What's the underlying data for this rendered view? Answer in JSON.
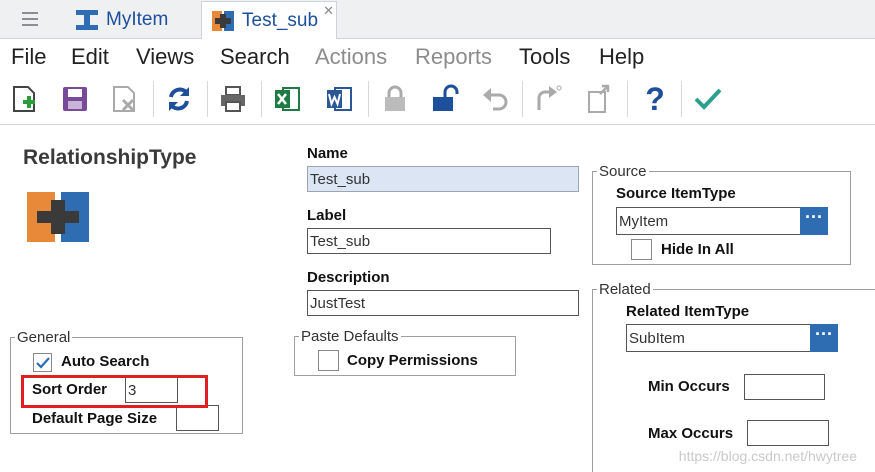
{
  "tabs": [
    {
      "label": "MyItem"
    },
    {
      "label": "Test_sub",
      "close": "✕"
    }
  ],
  "menu": [
    {
      "label": "File",
      "enabled": true
    },
    {
      "label": "Edit",
      "enabled": true
    },
    {
      "label": "Views",
      "enabled": true
    },
    {
      "label": "Search",
      "enabled": true
    },
    {
      "label": "Actions",
      "enabled": false
    },
    {
      "label": "Reports",
      "enabled": false
    },
    {
      "label": "Tools",
      "enabled": true
    },
    {
      "label": "Help",
      "enabled": true
    }
  ],
  "toolbar_icons": [
    "new-icon",
    "save-icon",
    "delete-icon",
    "refresh-icon",
    "print-icon",
    "excel-icon",
    "word-icon",
    "lock-icon",
    "unlock-icon",
    "undo-icon",
    "promote-icon",
    "export-icon",
    "help-icon",
    "done-icon"
  ],
  "colors": {
    "accent": "#1e4f9a",
    "orange": "#e8893a",
    "blue": "#2f6db3",
    "red": "#e02020",
    "green": "#2e9e8e"
  },
  "form": {
    "title": "RelationshipType",
    "name_label": "Name",
    "name_value": "Test_sub",
    "label_label": "Label",
    "label_value": "Test_sub",
    "description_label": "Description",
    "description_value": "JustTest",
    "general_legend": "General",
    "auto_search_label": "Auto Search",
    "auto_search_checked": true,
    "sort_order_label": "Sort Order",
    "sort_order_value": "3",
    "default_page_size_label": "Default Page Size",
    "default_page_size_value": "",
    "paste_defaults_legend": "Paste Defaults",
    "copy_permissions_label": "Copy Permissions",
    "copy_permissions_checked": false,
    "source_legend": "Source",
    "source_itemtype_label": "Source ItemType",
    "source_itemtype_value": "MyItem",
    "hide_in_all_label": "Hide In All",
    "hide_in_all_checked": false,
    "related_legend": "Related",
    "related_itemtype_label": "Related ItemType",
    "related_itemtype_value": "SubItem",
    "min_occurs_label": "Min Occurs",
    "min_occurs_value": "",
    "max_occurs_label": "Max Occurs",
    "max_occurs_value": "",
    "ellipsis": "···"
  },
  "watermark": "https://blog.csdn.net/hwytree"
}
